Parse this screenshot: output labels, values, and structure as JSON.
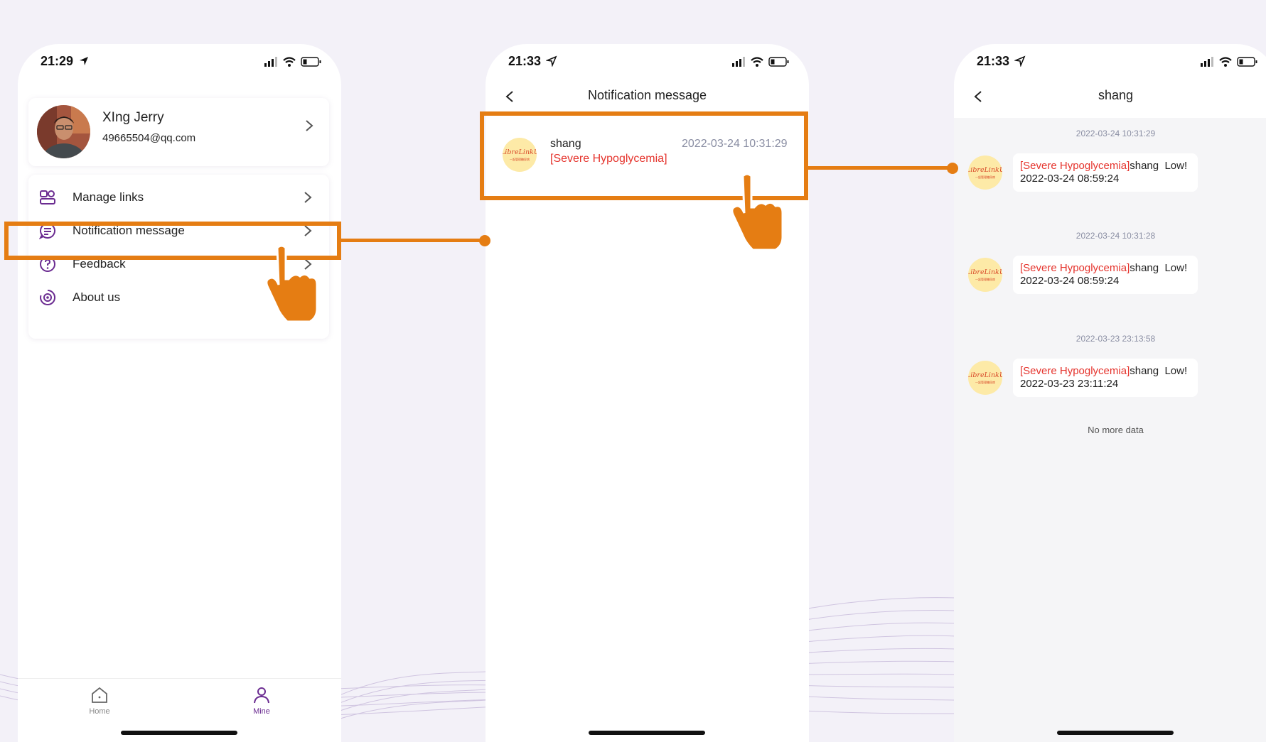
{
  "screens": [
    {
      "status": {
        "time": "21:29"
      },
      "profile": {
        "name": "XIng Jerry",
        "email": "49665504@qq.com"
      },
      "menu": [
        {
          "label": "Manage links",
          "icon": "manage-links-icon"
        },
        {
          "label": "Notification message",
          "icon": "message-icon"
        },
        {
          "label": "Feedback",
          "icon": "question-icon"
        },
        {
          "label": "About us",
          "icon": "about-icon"
        }
      ],
      "tabs": [
        {
          "label": "Home",
          "icon": "home-icon",
          "active": false
        },
        {
          "label": "Mine",
          "icon": "person-icon",
          "active": true
        }
      ]
    },
    {
      "status": {
        "time": "21:33"
      },
      "title": "Notification message",
      "notification": {
        "sender": "shang",
        "time": "2022-03-24 10:31:29",
        "alert": "[Severe Hypoglycemia]"
      }
    },
    {
      "status": {
        "time": "21:33"
      },
      "title": "shang",
      "messages": [
        {
          "timestamp": "2022-03-24 10:31:29",
          "tag": "[Severe Hypoglycemia]",
          "text": "shang  Low!",
          "reading_time": "2022-03-24 08:59:24"
        },
        {
          "timestamp": "2022-03-24 10:31:28",
          "tag": "[Severe Hypoglycemia]",
          "text": "shang  Low!",
          "reading_time": "2022-03-24 08:59:24"
        },
        {
          "timestamp": "2022-03-23 23:13:58",
          "tag": "[Severe Hypoglycemia]",
          "text": "shang  Low!",
          "reading_time": "2022-03-23 23:11:24"
        }
      ],
      "no_more": "No more data"
    }
  ],
  "logo": {
    "text": "LibreLinkUp",
    "sub": "一起管理糖尿病"
  },
  "colors": {
    "accent": "#e57d13",
    "brand_purple": "#6b2c91",
    "alert_red": "#e5332c",
    "muted_text": "#8a8ea3",
    "logo_bg": "#fdeaa7"
  }
}
